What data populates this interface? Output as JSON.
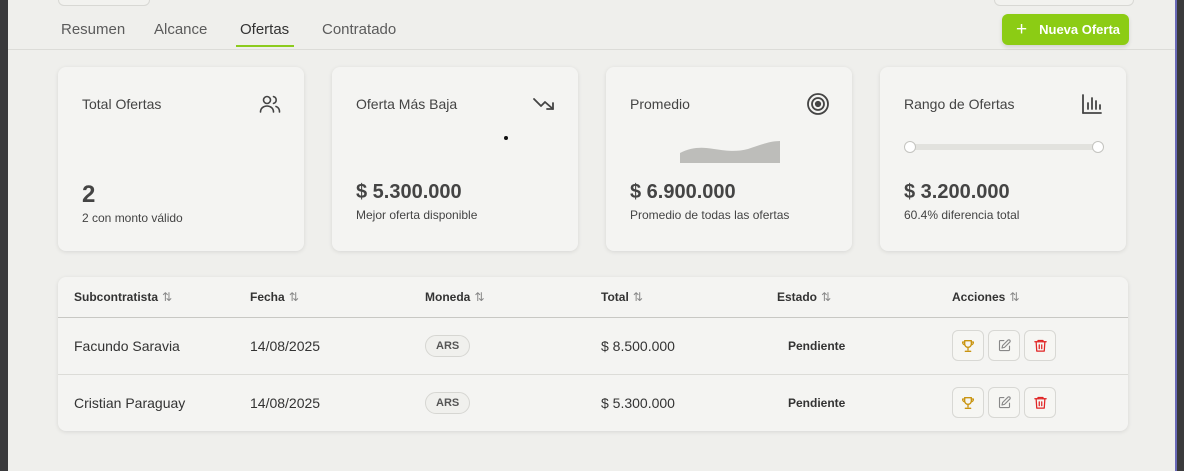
{
  "tabs": [
    {
      "label": "Resumen"
    },
    {
      "label": "Alcance"
    },
    {
      "label": "Ofertas"
    },
    {
      "label": "Contratado"
    }
  ],
  "active_tab": "Ofertas",
  "new_offer_button": {
    "label": "Nueva Oferta",
    "icon": "plus-icon"
  },
  "accent_color": "#8ccc14",
  "cards": [
    {
      "title": "Total Ofertas",
      "value": "2",
      "sub": "2 con monto válido",
      "icon": "users-icon"
    },
    {
      "title": "Oferta Más Baja",
      "value": "$ 5.300.000",
      "sub": "Mejor oferta disponible",
      "icon": "trending-down-icon"
    },
    {
      "title": "Promedio",
      "value": "$ 6.900.000",
      "sub": "Promedio de todas las ofertas",
      "icon": "target-icon"
    },
    {
      "title": "Rango de Ofertas",
      "value": "$ 3.200.000",
      "sub": "60.4% diferencia total",
      "icon": "bar-chart-icon"
    }
  ],
  "table": {
    "columns": [
      "Subcontratista",
      "Fecha",
      "Moneda",
      "Total",
      "Estado",
      "Acciones"
    ],
    "rows": [
      {
        "subcontratista": "Facundo Saravia",
        "fecha": "14/08/2025",
        "moneda": "ARS",
        "total": "$ 8.500.000",
        "estado": "Pendiente"
      },
      {
        "subcontratista": "Cristian Paraguay",
        "fecha": "14/08/2025",
        "moneda": "ARS",
        "total": "$ 5.300.000",
        "estado": "Pendiente"
      }
    ],
    "action_icons": [
      "trophy-icon",
      "edit-icon",
      "trash-icon"
    ]
  }
}
